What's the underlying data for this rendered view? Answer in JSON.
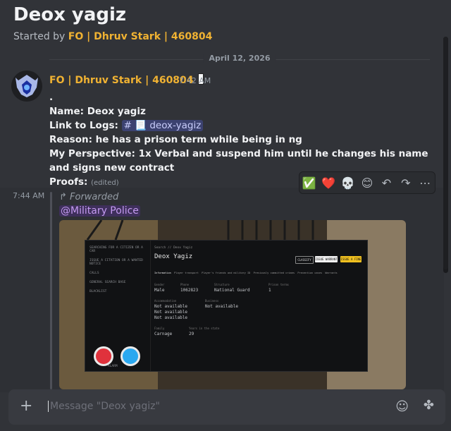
{
  "thread": {
    "title": "Deox yagiz",
    "started_prefix": "Started by",
    "started_by": "FO | Dhruv Stark | 460804"
  },
  "date_divider": "April 12, 2026",
  "message": {
    "author": "FO | Dhruv Stark | 460804",
    "time": "7:42 AM",
    "lines": [
      ".",
      "Name: Deox yagiz",
      "Link to Logs:",
      "Reason: he has a prison term while being in ng",
      "My Perspective: 1x Verbal and suspend him until he changes his name and signs new contract",
      "Proofs:"
    ],
    "channel_link": "# 📃 deox-yagiz",
    "edited": "(edited)"
  },
  "reactions": [
    "✅",
    "❤️",
    "💀",
    "😊",
    "↶",
    "↷",
    "⋯"
  ],
  "forward": {
    "time": "7:44 AM",
    "label": "↱ Forwarded",
    "mention": "@Military Police"
  },
  "screenshot_content": {
    "sidebar": [
      "SEARCHING FOR A CITIZEN OR A CAR",
      "ISSUE A CITATION OR A WANTED NOTICE",
      "CALLS",
      "GENERAL SEARCH BASE",
      "BLACKLIST"
    ],
    "breadcrumb": "Search // Deox Yagiz",
    "name": "Deox Yagiz",
    "buttons": [
      "CLASSIFY",
      "ISSUE WARRANT",
      "ISSUE A FINE"
    ],
    "tabs": [
      "Information",
      "Player transport",
      "Player's friends and military ID",
      "Previously committed crimes",
      "Prevention cases",
      "Warrants"
    ],
    "gender_label": "Gender",
    "gender": "Male",
    "phone_label": "Phone",
    "phone": "1062823",
    "structure_label": "Structure",
    "structure": "National Guard",
    "prison_label": "Prison terms",
    "prison": "1",
    "accommodation_label": "Accommodation",
    "accommodation": [
      "Not available",
      "Not available",
      "Not available"
    ],
    "business_label": "Business",
    "business": "Not available",
    "family_label": "Family",
    "family": "Carnage",
    "years_label": "Years in the state",
    "years": "29",
    "alarm": "ALARM"
  },
  "composer": {
    "placeholder": "Message \"Deox yagiz\""
  }
}
